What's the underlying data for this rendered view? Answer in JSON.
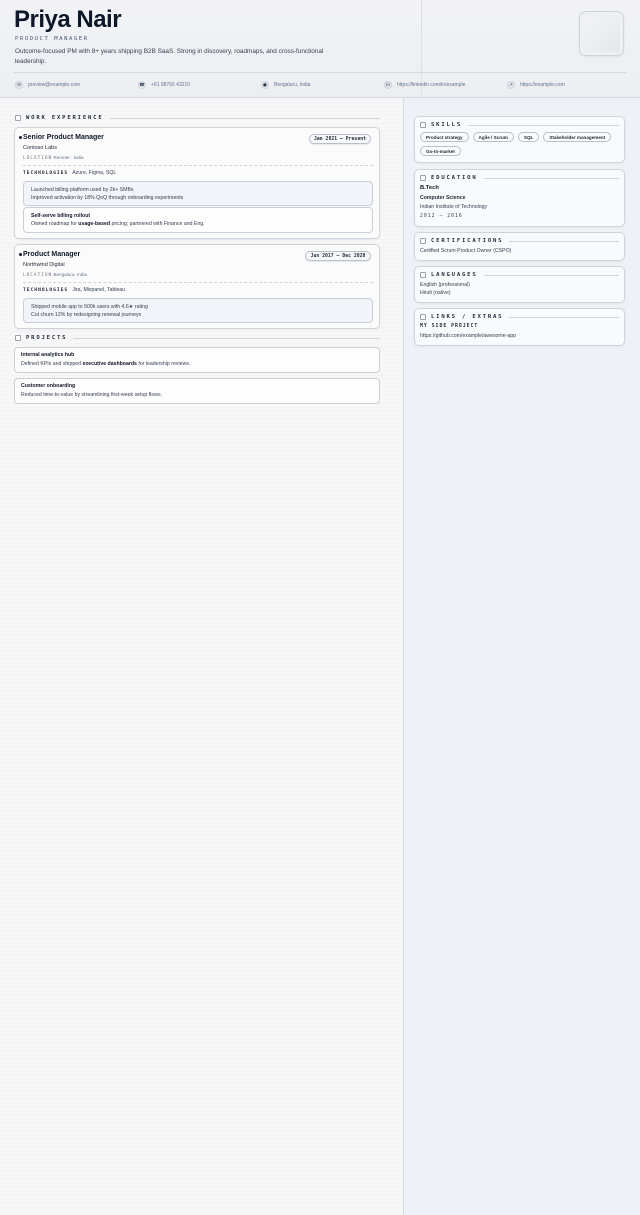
{
  "header": {
    "name": "Priya Nair",
    "role": "PRODUCT MANAGER",
    "summary": "Outcome-focused PM with 8+ years shipping B2B SaaS. Strong in discovery, roadmaps, and cross-functional leadership.",
    "contacts": [
      {
        "icon": "mail-icon",
        "text": "preview@example.com"
      },
      {
        "icon": "phone-icon",
        "text": "+91 98765 43210"
      },
      {
        "icon": "location-pin-icon",
        "text": "Bengaluru, India"
      },
      {
        "icon": "linkedin-icon",
        "text": "https://linkedin.com/in/example"
      },
      {
        "icon": "link-icon",
        "text": "https://example.com"
      }
    ]
  },
  "sections": {
    "work": "WORK EXPERIENCE",
    "projects": "PROJECTS",
    "skills": "SKILLS",
    "education": "EDUCATION",
    "certifications": "CERTIFICATIONS",
    "languages": "LANGUAGES",
    "links": "LINKS / EXTRAS"
  },
  "labels": {
    "location": "LOCATION",
    "technologies": "TECHNOLOGIES"
  },
  "jobs": [
    {
      "title": "Senior Product Manager",
      "company": "Contoso Labs",
      "location": "Remote · India",
      "dates": "Jan 2021 — Present",
      "technologies": "Azure, Figma, SQL",
      "highlights": [
        "Launched billing platform used by 2k+ SMBs",
        "Improved activation by 18% QoQ through onboarding experiments"
      ],
      "sub_title": "Self-serve billing rollout",
      "sub_pre": "Owned roadmap for ",
      "sub_bold": "usage-based",
      "sub_post": " pricing; partnered with Finance and Eng."
    },
    {
      "title": "Product Manager",
      "company": "Northwind Digital",
      "location": "Bengaluru, India",
      "dates": "Jun 2017 — Dec 2020",
      "technologies": "Jira, Mixpanel, Tableau",
      "highlights": [
        "Shipped mobile app to 500k users with 4.6★ rating",
        "Cut churn 12% by redesigning renewal journeys"
      ]
    }
  ],
  "projects": [
    {
      "title": "Internal analytics hub",
      "desc_pre": "Defined KPIs and shipped ",
      "desc_bold": "executive dashboards",
      "desc_post": " for leadership reviews."
    },
    {
      "title": "Customer onboarding",
      "desc": "Reduced time-to-value by streamlining first-week setup flows."
    }
  ],
  "skills": [
    "Product strategy",
    "Agile / Scrum",
    "SQL",
    "Stakeholder management",
    "Go-to-market"
  ],
  "education": {
    "degree": "B.Tech",
    "field": "Computer Science",
    "school": "Indian Institute of Technology",
    "years": "2012 — 2016"
  },
  "certifications": [
    "Certified Scrum Product Owner (CSPO)"
  ],
  "languages": [
    "English (professional)",
    "Hindi (native)"
  ],
  "links": {
    "label": "MY SIDE PROJECT",
    "url": "https://github.com/example/awesome-app"
  }
}
